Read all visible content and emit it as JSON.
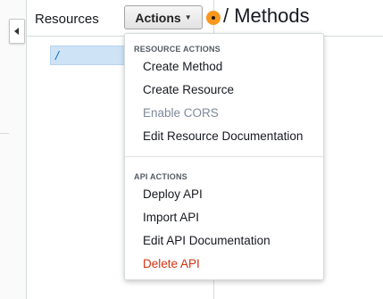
{
  "resources_panel": {
    "title": "Resources",
    "items": [
      {
        "label": "/"
      }
    ]
  },
  "actions_button": {
    "label": "Actions"
  },
  "methods_header": {
    "title": "/ Methods"
  },
  "dropdown": {
    "sections": [
      {
        "header": "RESOURCE ACTIONS",
        "items": [
          {
            "label": "Create Method",
            "state": "enabled"
          },
          {
            "label": "Create Resource",
            "state": "enabled"
          },
          {
            "label": "Enable CORS",
            "state": "disabled"
          },
          {
            "label": "Edit Resource Documentation",
            "state": "enabled"
          }
        ]
      },
      {
        "header": "API ACTIONS",
        "items": [
          {
            "label": "Deploy API",
            "state": "enabled"
          },
          {
            "label": "Import API",
            "state": "enabled"
          },
          {
            "label": "Edit API Documentation",
            "state": "enabled"
          },
          {
            "label": "Delete API",
            "state": "danger"
          }
        ]
      }
    ]
  },
  "colors": {
    "accent_orange": "#f7981d",
    "danger_red": "#d13212",
    "selected_bg": "#cfe3f7",
    "disabled_text": "#7d8998"
  },
  "icons": {
    "collapse": "chevron-left-icon",
    "dropdown_caret": "caret-down-icon",
    "status_dot": "orange-dot-icon"
  }
}
